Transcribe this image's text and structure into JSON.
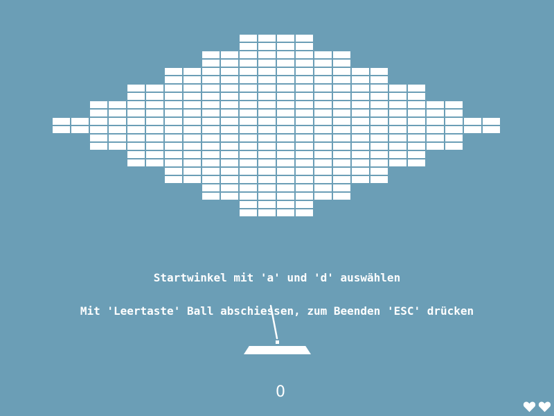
{
  "game": {
    "background_color": "#6b9eb6",
    "foreground_color": "#ffffff",
    "instructions": [
      "Startwinkel mit 'a' und 'd' auswählen",
      "Mit 'Leertaste' Ball abschiessen, zum Beenden 'ESC' drücken"
    ],
    "score": "0",
    "lives": 2,
    "life_icon": "heart-icon",
    "bricks": {
      "row_half_widths": [
        2,
        2,
        4,
        4,
        6,
        6,
        8,
        8,
        10,
        10,
        12,
        12,
        10,
        10,
        8,
        8,
        6,
        6,
        4,
        4,
        2,
        2
      ],
      "total": 264
    }
  }
}
